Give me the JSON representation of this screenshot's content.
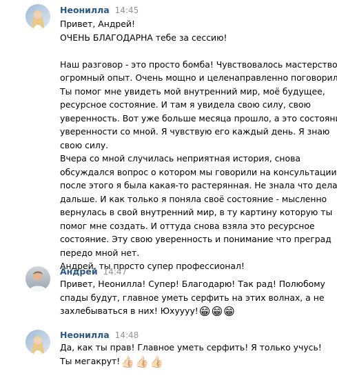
{
  "messages": [
    {
      "author": "Неонилла",
      "time": "14:45",
      "avatar": "neonilla-avatar",
      "lines": [
        "Привет, Андрей!",
        "ОЧЕНЬ БЛАГОДАРНА тебе за сессию!",
        "",
        "Наш разговор - это просто бомба! Чувствовалось мастерство и",
        "огромный опыт. Очень мощно и целенаправленно поговорили.",
        "Ты помог мне увидеть мой внутренний мир, моё будущее,",
        "ресурсное состояние. И там я увидела свою силу, свою",
        "уверенность. Вот уже больше месяца прошло, а это состояние",
        "уверенности со мной. Я чувствую его каждый день. Я знаю",
        "свою силу.",
        "Вчера со мной случилась неприятная история, снова",
        "обсуждался вопрос о котором мы говорили на консультации, и",
        "после этого я была какая-то растерянная. Не знала что делать",
        "дальше. И как только я поняла своё состояние - мысленно",
        "вернулась в свой внутренний мир, в ту картину которую ты",
        "помог мне создать. И оттуда снова взяла это ресурсное",
        "состояние. Эту свою уверенность и понимание что преград",
        "передо мной нет.",
        "Андрей, ты просто супер профессионал!"
      ]
    },
    {
      "author": "Андрей",
      "time": "14:47",
      "avatar": "andrey-avatar",
      "lines": [
        "Привет, Неонилла! Супер! Благодарю! Так рад! Полюбому",
        "спады будут, главное уметь серфить на этих волнах, а не",
        "захлебываться в них! Юхуууу!"
      ],
      "emoji": [
        "😁",
        "😁",
        "😁"
      ]
    },
    {
      "author": "Неонилла",
      "time": "14:48",
      "avatar": "neonilla-avatar",
      "lines": [
        "Да, как ты прав! Главное уметь серфить! Я только учусь!",
        "Ты мегакрут!"
      ],
      "emoji": [
        "👍🏻",
        "👍🏻",
        "👍🏻"
      ]
    }
  ]
}
